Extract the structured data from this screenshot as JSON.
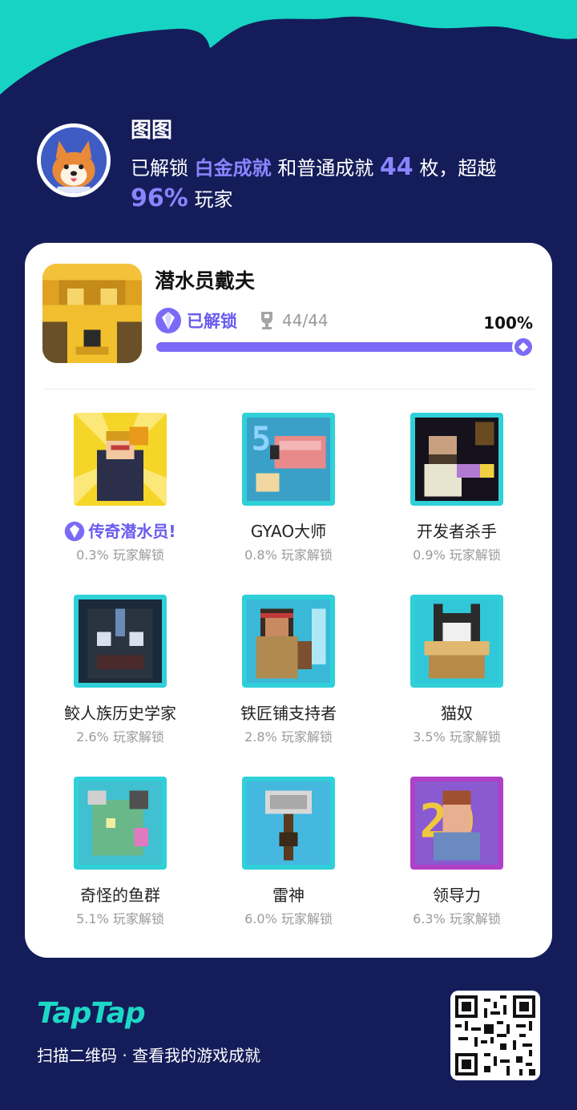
{
  "user": {
    "name": "图图",
    "summary_prefix": "已解锁",
    "platinum": "白金成就",
    "summary_mid": "和普通成就",
    "count": "44",
    "summary_mid2": "枚，超越",
    "percent": "96%",
    "summary_suffix": "玩家"
  },
  "game": {
    "title": "潜水员戴夫",
    "status": "已解锁",
    "achievements_count": "44/44",
    "progress_percent": "100%",
    "progress_fraction": 1.0
  },
  "achievements": [
    {
      "name": "传奇潜水员!",
      "rate": "0.3% 玩家解锁",
      "special": true,
      "icon": "legend-diver-icon"
    },
    {
      "name": "GYAO大师",
      "rate": "0.8% 玩家解锁",
      "icon": "fish-icon"
    },
    {
      "name": "开发者杀手",
      "rate": "0.9% 玩家解锁",
      "icon": "developer-icon"
    },
    {
      "name": "鲛人族历史学家",
      "rate": "2.6% 玩家解锁",
      "icon": "seapeople-icon"
    },
    {
      "name": "铁匠铺支持者",
      "rate": "2.8% 玩家解锁",
      "icon": "blacksmith-icon"
    },
    {
      "name": "猫奴",
      "rate": "3.5% 玩家解锁",
      "icon": "cat-icon"
    },
    {
      "name": "奇怪的鱼群",
      "rate": "5.1% 玩家解锁",
      "icon": "strange-fish-icon"
    },
    {
      "name": "雷神",
      "rate": "6.0% 玩家解锁",
      "icon": "hammer-icon"
    },
    {
      "name": "领导力",
      "rate": "6.3% 玩家解锁",
      "icon": "leader-icon"
    }
  ],
  "footer": {
    "logo": "TapTap",
    "caption": "扫描二维码 · 查看我的游戏成就"
  },
  "colors": {
    "background": "#141d5a",
    "accent": "#7b6af6",
    "teal": "#1ed8c6"
  }
}
